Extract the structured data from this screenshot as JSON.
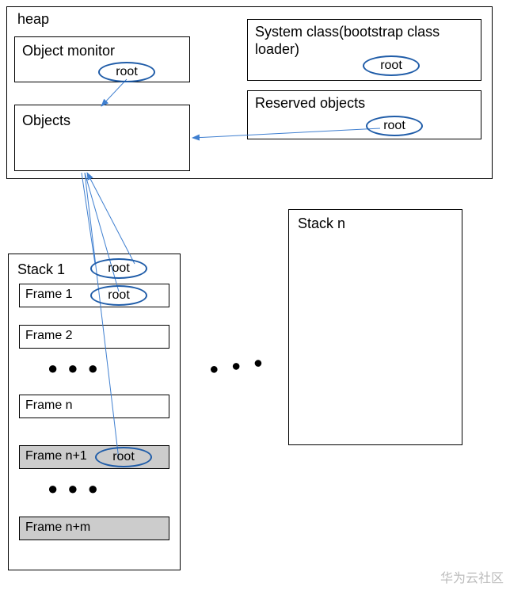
{
  "heap": {
    "title": "heap",
    "object_monitor": {
      "label": "Object monitor",
      "root": "root"
    },
    "objects": {
      "label": "Objects"
    },
    "system_class": {
      "label": "System class(bootstrap class loader)",
      "root": "root"
    },
    "reserved_objects": {
      "label": "Reserved objects",
      "root": "root"
    }
  },
  "stack1": {
    "title": "Stack 1",
    "title_root": "root",
    "frames": {
      "f1": {
        "label": "Frame 1",
        "root": "root"
      },
      "f2": {
        "label": "Frame 2"
      },
      "fn": {
        "label": "Frame n"
      },
      "fn1": {
        "label": "Frame n+1",
        "root": "root"
      },
      "fnm": {
        "label": "Frame n+m"
      }
    }
  },
  "stackn": {
    "title": "Stack n"
  },
  "dots": "●  ●  ●",
  "watermark": "华为云社区"
}
